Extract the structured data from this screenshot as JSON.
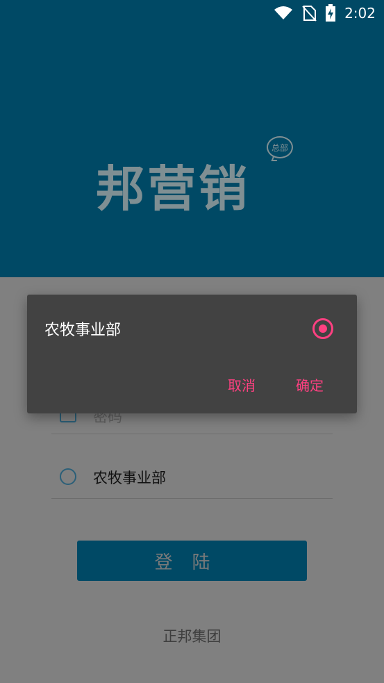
{
  "status_bar": {
    "time": "2:02",
    "icons": [
      "wifi-icon",
      "no-sim-icon",
      "battery-charging-icon"
    ]
  },
  "header": {
    "logo_text": "邦营销",
    "logo_badge": "总部"
  },
  "form": {
    "password_placeholder": "密码",
    "department_value": "农牧事业部",
    "login_button": "登陆",
    "footer": "正邦集团"
  },
  "dialog": {
    "option_label": "农牧事业部",
    "option_selected": true,
    "cancel_label": "取消",
    "confirm_label": "确定"
  },
  "colors": {
    "header_bg": "#004965",
    "accent": "#ff4081",
    "dialog_bg": "#424242"
  }
}
